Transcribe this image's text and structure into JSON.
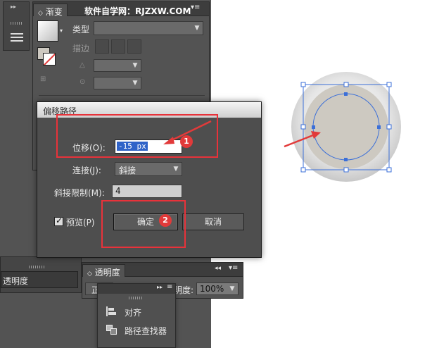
{
  "watermark": "软件自学网：RJZXW.COM",
  "gradient_panel": {
    "tab_label": "渐变",
    "type_label": "类型",
    "type_value": "",
    "stroke_label": "描边",
    "angle_value": "",
    "aspect_value": ""
  },
  "dialog": {
    "title": "偏移路径",
    "offset_label": "位移(O):",
    "offset_value": "-15 px",
    "join_label": "连接(J):",
    "join_value": "斜接",
    "miter_label": "斜接限制(M):",
    "miter_value": "4",
    "preview_label": "预览(P)",
    "preview_checked": true,
    "ok_label": "确定",
    "cancel_label": "取消"
  },
  "annotations": {
    "badge_1": "1",
    "badge_2": "2",
    "highlight_color": "#e8323a"
  },
  "transparency_panel": {
    "tab_label": "透明度",
    "left_label": "透明度",
    "mode_value": "正",
    "opacity_label": "明度:",
    "opacity_value": "100%"
  },
  "popup_menu": {
    "items": [
      {
        "label": "对齐",
        "icon": "align-icon"
      },
      {
        "label": "路径查找器",
        "icon": "pathfinder-icon"
      }
    ]
  },
  "colors": {
    "panel_bg": "#535353",
    "accent_red": "#e23a3a",
    "selection_blue": "#3b6fd8",
    "shape_fill": "#cdc9c1"
  }
}
